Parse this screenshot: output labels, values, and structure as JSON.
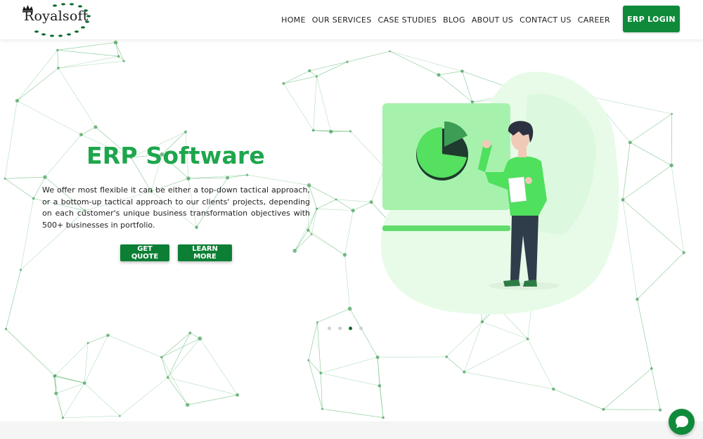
{
  "brand": {
    "name": "Royalsoft",
    "logo_icon": "crown-icon",
    "accent": "#1ea64d",
    "dark_accent": "#0d7f35"
  },
  "nav": {
    "items": [
      {
        "label": "HOME"
      },
      {
        "label": "OUR SERVICES"
      },
      {
        "label": "CASE STUDIES"
      },
      {
        "label": "BLOG"
      },
      {
        "label": "ABOUT US"
      },
      {
        "label": "CONTACT US"
      },
      {
        "label": "CAREER"
      }
    ],
    "cta_label": "ERP LOGIN"
  },
  "hero": {
    "title": "ERP Software",
    "description": "We offer most flexible it can be either a top-down tactical approach, or a bottom-up tactical approach to our clients' projects, depending on each customer's unique business transformation objectives with 500+ businesses in portfolio.",
    "buttons": {
      "quote": "GET QUOTE",
      "learn": "LEARN MORE"
    },
    "illustration_icon": "presenter-pie-chart-illustration"
  },
  "slider": {
    "count": 4,
    "active_index": 2
  },
  "chat": {
    "icon": "chat-bubble-icon"
  }
}
